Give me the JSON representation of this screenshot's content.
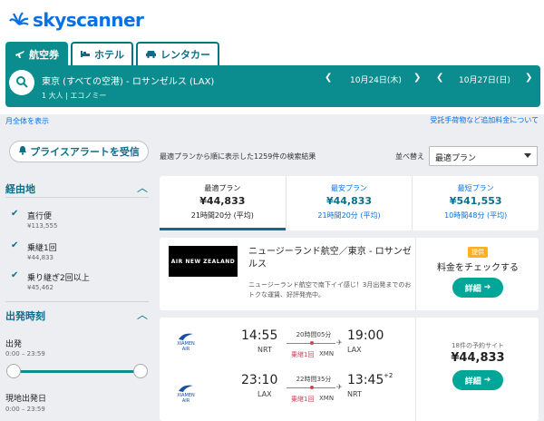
{
  "brand": {
    "name": "skyscanner"
  },
  "tabs": [
    {
      "label": "航空券",
      "icon": "plane-icon",
      "active": true
    },
    {
      "label": "ホテル",
      "icon": "bed-icon",
      "active": false
    },
    {
      "label": "レンタカー",
      "icon": "car-icon",
      "active": false
    }
  ],
  "search": {
    "route": "東京 (すべての空港) - ロサンゼルス (LAX)",
    "passengers": "1 大人 | エコノミー",
    "depart_date": "10月24日(木)",
    "return_date": "10月27日(日)"
  },
  "subbar": {
    "left_link": "月全体を表示",
    "right_link": "受託手荷物など追加料金について"
  },
  "sidebar": {
    "alert_button": "プライスアラートを受信",
    "stops_heading": "経由地",
    "stops": [
      {
        "label": "直行便",
        "price": "¥113,555"
      },
      {
        "label": "乗継1回",
        "price": "¥44,833"
      },
      {
        "label": "乗り継ぎ2回以上",
        "price": "¥45,462"
      }
    ],
    "time_heading": "出発時刻",
    "departure_label": "出発",
    "departure_range": "0:00 – 23:59",
    "return_label": "現地出発日",
    "return_range": "0:00 – 23:59"
  },
  "results": {
    "info": "最適プランから順に表示した1259件の検索結果",
    "sort_label": "並べ替え",
    "sort_value": "最適プラン"
  },
  "categories": [
    {
      "title": "最適プラン",
      "price": "¥44,833",
      "duration": "21時間20分 (平均)"
    },
    {
      "title": "最安プラン",
      "price": "¥44,833",
      "duration": "21時間20分 (平均)"
    },
    {
      "title": "最短プラン",
      "price": "¥541,553",
      "duration": "10時間48分 (平均)"
    }
  ],
  "ad": {
    "logo_text": "AIR NEW ZEALAND",
    "title": "ニュージーランド航空／東京 - ロサンゼルス",
    "description": "ニュージーランド航空で南下イイ感じ！3月出発までのおトクな運賃、好評発売中。",
    "badge": "提供",
    "check_text": "料金をチェックする",
    "button": "詳細"
  },
  "flight": {
    "airline": "XIAMEN AIR",
    "legs": [
      {
        "dep_time": "14:55",
        "dep_airport": "NRT",
        "arr_time": "19:00",
        "arr_airport": "LAX",
        "duration": "20時間05分",
        "stops": "乗継1回",
        "via": "XMN",
        "day_offset": ""
      },
      {
        "dep_time": "23:10",
        "dep_airport": "LAX",
        "arr_time": "13:45",
        "arr_airport": "NRT",
        "duration": "22時間35分",
        "stops": "乗継1回",
        "via": "XMN",
        "day_offset": "+2"
      }
    ],
    "sites": "18件の予約サイト",
    "price": "¥44,833",
    "button": "詳細"
  },
  "colors": {
    "teal": "#0b8c8e",
    "brand_blue": "#0770e3",
    "green": "#00a698",
    "stop_red": "#d1435b"
  }
}
